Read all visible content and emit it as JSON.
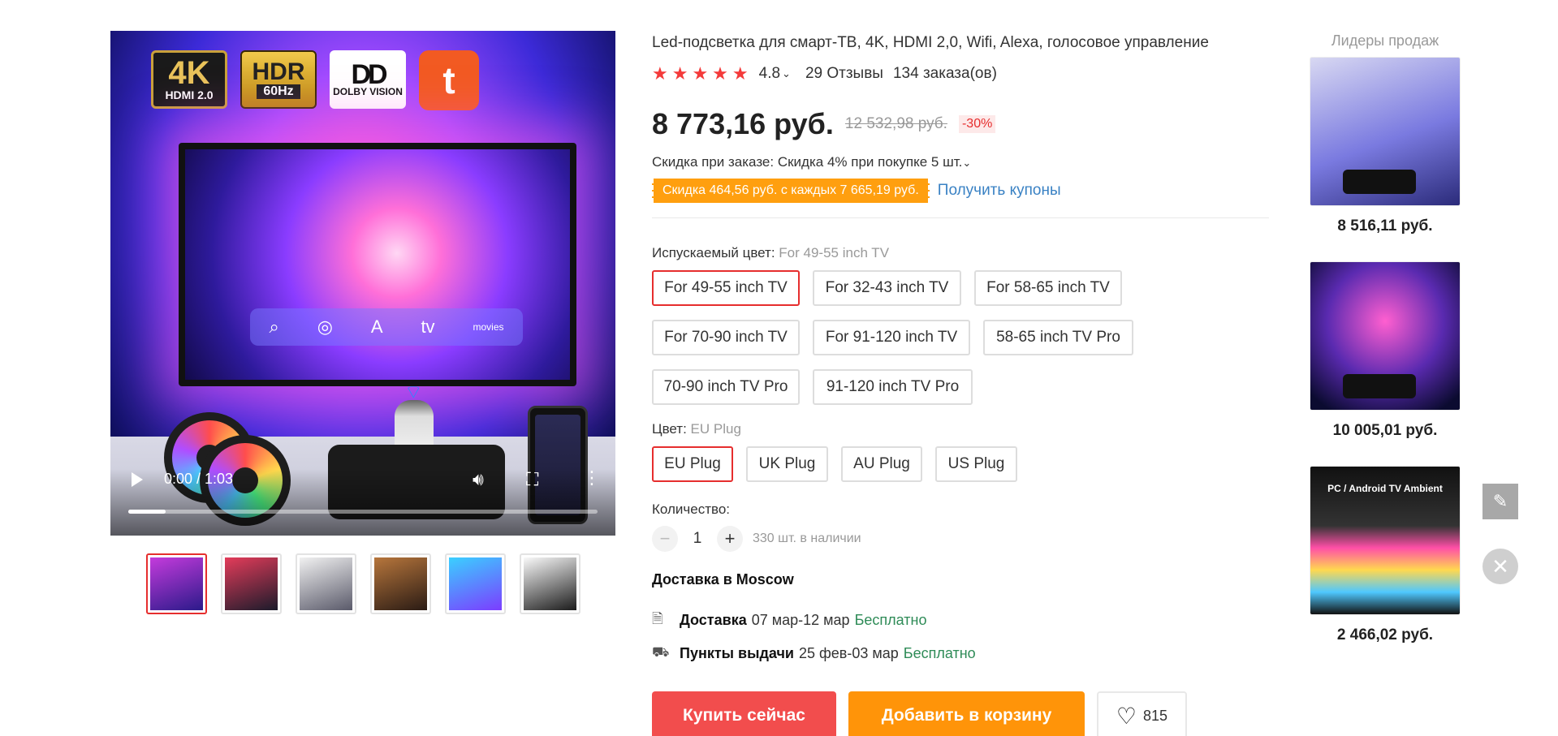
{
  "gallery": {
    "badges": {
      "k4_big": "4K",
      "k4_small": "HDMI 2.0",
      "hdr_big": "HDR",
      "hdr_small": "60Hz",
      "dolby_logo": "DD",
      "dolby_text": "DOLBY VISION",
      "tuya_glyph": "t"
    },
    "tv_dock": [
      "⌕",
      "◎",
      "A",
      "tv",
      "movies"
    ],
    "video": {
      "time": "0:00 / 1:03",
      "progress_fraction": 0.08
    },
    "thumbnails": [
      {
        "colors": [
          "#c43bdc",
          "#2b1a8a"
        ],
        "active": true
      },
      {
        "colors": [
          "#e43c5a",
          "#1b1b2b"
        ],
        "active": false
      },
      {
        "colors": [
          "#f1f1f1",
          "#5a5a6a"
        ],
        "active": false
      },
      {
        "colors": [
          "#b7763c",
          "#2a1b14"
        ],
        "active": false
      },
      {
        "colors": [
          "#3ad0ff",
          "#7c3cff"
        ],
        "active": false
      },
      {
        "colors": [
          "#fafafa",
          "#1b1b1b"
        ],
        "active": false
      }
    ]
  },
  "product": {
    "title": "Led-подсветка для смарт-ТВ, 4K, HDMI 2,0, Wifi, Alexa, голосовое управление",
    "stars": "★★★★★",
    "rating": "4.8",
    "reviews": "29 Отзывы",
    "orders": "134 заказа(ов)",
    "price": "8 773,16 руб.",
    "old_price": "12 532,98 руб.",
    "discount": "-30%",
    "bulk_discount": "Скидка при заказе: Скидка 4% при покупке 5 шт.",
    "coupon": "Скидка 464,56 руб. с каждых 7 665,19 руб.",
    "coupon_link": "Получить купоны",
    "emitted_color_label": "Испускаемый цвет: ",
    "emitted_color_value": "For 49-55 inch TV",
    "sizes": [
      "For 49-55 inch TV",
      "For 32-43 inch TV",
      "For 58-65 inch TV",
      "For 70-90 inch TV",
      "For 91-120 inch TV",
      "58-65 inch TV Pro",
      "70-90 inch TV Pro",
      "91-120 inch TV Pro"
    ],
    "color_label": "Цвет: ",
    "color_value": "EU Plug",
    "plugs": [
      "EU Plug",
      "UK Plug",
      "AU Plug",
      "US Plug"
    ],
    "quantity_label": "Количество:",
    "quantity": "1",
    "minus": "−",
    "plus": "+",
    "stock": "330 шт. в наличии",
    "delivery_title": "Доставка в Moscow",
    "delivery": {
      "icon": "🗎",
      "label": "Доставка",
      "dates": "07 мар-12 мар",
      "cost": "Бесплатно"
    },
    "pickup": {
      "icon": "⛟",
      "label": "Пункты выдачи",
      "dates": "25 фев-03 мар",
      "cost": "Бесплатно"
    },
    "buy_now": "Купить сейчас",
    "add_to_cart": "Добавить в корзину",
    "wishlist_count": "815",
    "heart_glyph": "♡"
  },
  "sidebar": {
    "title": "Лидеры продаж",
    "items": [
      {
        "price": "8 516,11 руб."
      },
      {
        "price": "10 005,01 руб."
      },
      {
        "caption": "PC / Android TV Ambient",
        "price": "2 466,02 руб."
      }
    ]
  },
  "tools": {
    "edit_glyph": "✎",
    "close_glyph": "✕"
  }
}
